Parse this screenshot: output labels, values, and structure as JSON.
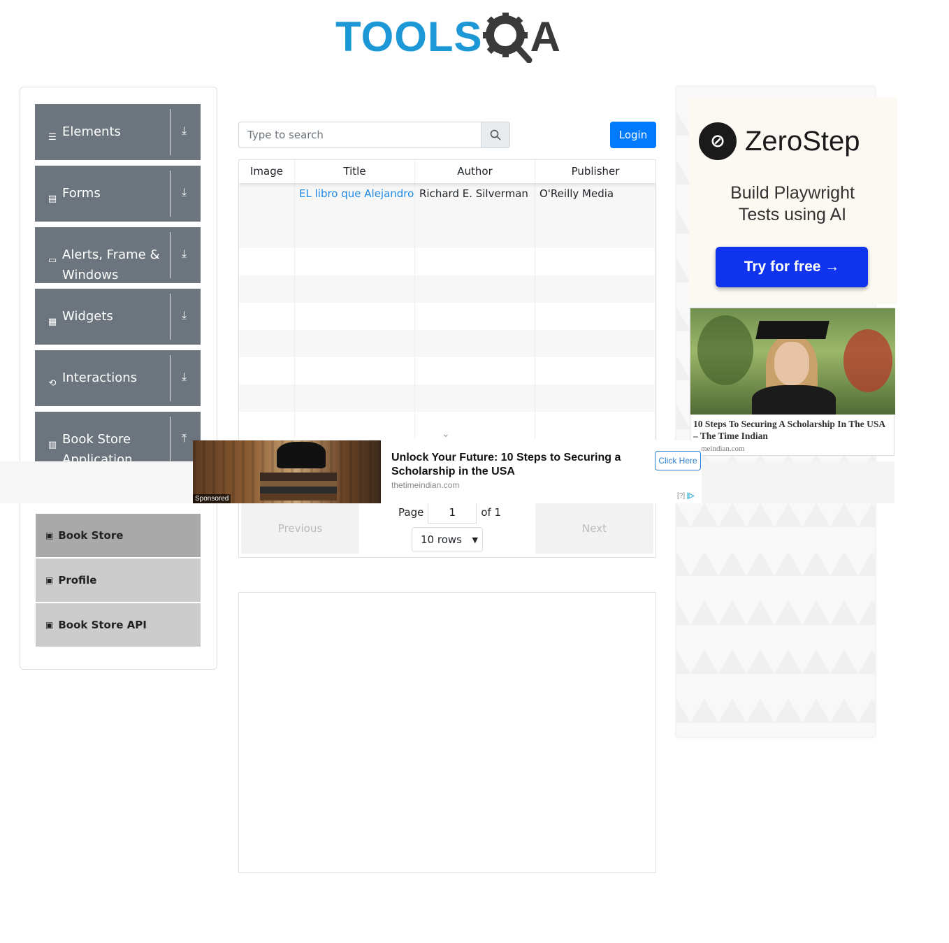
{
  "header": {
    "logo_tools": "TOOLS",
    "logo_qa": "QA"
  },
  "sidebar": {
    "groups": [
      {
        "label": "Elements",
        "icon": "menu-icon",
        "arrow": "⤓"
      },
      {
        "label": "Forms",
        "icon": "form-icon",
        "arrow": "⤓"
      },
      {
        "label": "Alerts, Frame & Windows",
        "icon": "window-icon",
        "arrow": "⤓"
      },
      {
        "label": "Widgets",
        "icon": "widgets-icon",
        "arrow": "⤓"
      },
      {
        "label": "Interactions",
        "icon": "interactions-icon",
        "arrow": "⤓"
      },
      {
        "label": "Book Store Application",
        "icon": "books-icon",
        "arrow": "⤒"
      }
    ],
    "subitems": [
      {
        "label": "Book Store",
        "active": true
      },
      {
        "label": "Profile",
        "active": false
      },
      {
        "label": "Book Store API",
        "active": false
      }
    ]
  },
  "search": {
    "placeholder": "Type to search"
  },
  "login_label": "Login",
  "table": {
    "headers": [
      "Image",
      "Title",
      "Author",
      "Publisher"
    ],
    "rows": [
      {
        "image": "",
        "title": "EL libro que Alejandro r",
        "author": "Richard E. Silverman",
        "publisher": "O'Reilly Media"
      }
    ]
  },
  "pagination": {
    "previous": "Previous",
    "next": "Next",
    "page_label": "Page",
    "page_value": "1",
    "of_label": "of 1",
    "rows_option": "10 rows"
  },
  "ad_right": {
    "brand": "ZeroStep",
    "tagline_1": "Build Playwright",
    "tagline_2": "Tests using AI",
    "cta": "Try for free →",
    "card_title": "10 Steps To Securing A Scholarship In The USA – The Time Indian",
    "card_source": "etimeindian.com"
  },
  "ad_banner": {
    "sponsored": "Sponsored",
    "title": "Unlock Your Future: 10 Steps to Securing a Scholarship in the USA",
    "source": "thetimeindian.com",
    "cta": "Click Here",
    "adchoice": "[?]"
  },
  "colors": {
    "sidebar_group": "#6c757d",
    "primary": "#007bff",
    "link": "#1e88e5",
    "logo_blue": "#1c98d6"
  }
}
